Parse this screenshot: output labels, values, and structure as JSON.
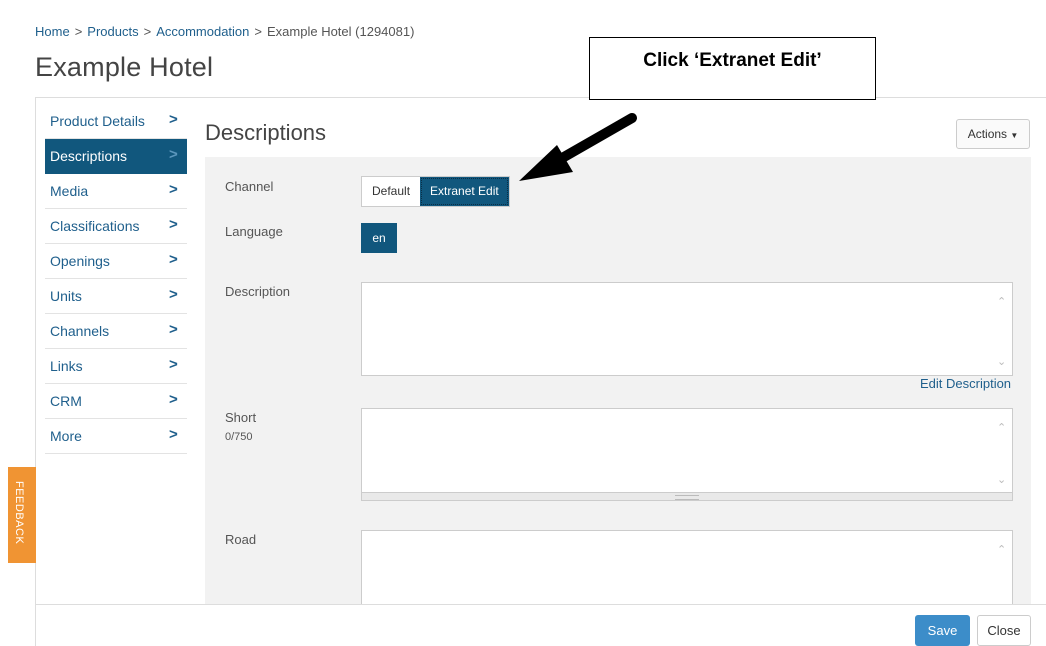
{
  "breadcrumb": {
    "items": [
      "Home",
      "Products",
      "Accommodation"
    ],
    "separator": ">",
    "current": "Example Hotel (1294081)"
  },
  "page_title": "Example Hotel",
  "sidebar": {
    "items": [
      {
        "label": "Product Details",
        "active": false
      },
      {
        "label": "Descriptions",
        "active": true
      },
      {
        "label": "Media",
        "active": false
      },
      {
        "label": "Classifications",
        "active": false
      },
      {
        "label": "Openings",
        "active": false
      },
      {
        "label": "Units",
        "active": false
      },
      {
        "label": "Channels",
        "active": false
      },
      {
        "label": "Links",
        "active": false
      },
      {
        "label": "CRM",
        "active": false
      },
      {
        "label": "More",
        "active": false
      }
    ],
    "chevron": ">"
  },
  "section": {
    "title": "Descriptions",
    "actions_label": "Actions"
  },
  "form": {
    "channel_label": "Channel",
    "channel_options": [
      "Default",
      "Extranet Edit"
    ],
    "channel_selected": "Extranet Edit",
    "language_label": "Language",
    "language_value": "en",
    "description_label": "Description",
    "description_value": "",
    "edit_description_link": "Edit Description",
    "short_label": "Short",
    "short_counter": "0/750",
    "short_value": "",
    "road_label": "Road",
    "road_value": ""
  },
  "footer": {
    "save_label": "Save",
    "close_label": "Close"
  },
  "feedback_tab": "FEEDBACK",
  "annotation": {
    "text": "Click ‘Extranet Edit’"
  },
  "colors": {
    "active_nav": "#11577d",
    "link": "#1f5f8c",
    "save_button": "#3c8dc9",
    "feedback_tab": "#f09433"
  }
}
